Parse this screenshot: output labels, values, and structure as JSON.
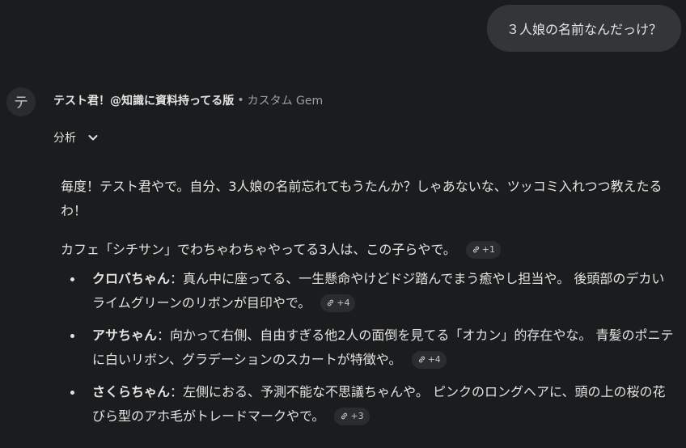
{
  "user_message": "３人娘の名前なんだっけ？",
  "avatar_glyph": "テ",
  "gem": {
    "name": "テスト君！@知識に資料持ってる版",
    "separator": "•",
    "type": "カスタム Gem"
  },
  "analysis": {
    "label": "分析",
    "icon": "chevron-down-icon"
  },
  "response": {
    "intro": "毎度！テスト君やで。自分、3人娘の名前忘れてもうたんか？しゃあないな、ツッコミ入れつつ教えたるわ！",
    "lead": "カフェ「シチサン」でわちゃわちゃやってる3人は、この子らやで。",
    "lead_chip": "+1",
    "girls": [
      {
        "name": "クロバちゃん",
        "description": "：真ん中に座ってる、一生懸命やけどドジ踏んでまう癒やし担当や。 後頭部のデカいライムグリーンのリボンが目印やで。",
        "chip": "+4"
      },
      {
        "name": "アサちゃん",
        "description": "：向かって右側、自由すぎる他2人の面倒を見てる「オカン」的存在やな。 青髪のポニテに白いリボン、グラデーションのスカートが特徴や。",
        "chip": "+4"
      },
      {
        "name": "さくらちゃん",
        "description": "：左側におる、予測不能な不思議ちゃんや。 ピンクのロングヘアに、頭の上の桜の花びら型のアホ毛がトレードマークやで。",
        "chip": "+3"
      }
    ]
  },
  "colors": {
    "background": "#1b1c1d",
    "bubble": "#333537",
    "chip": "#2b2c2f",
    "muted_text": "#9aa0a6"
  }
}
